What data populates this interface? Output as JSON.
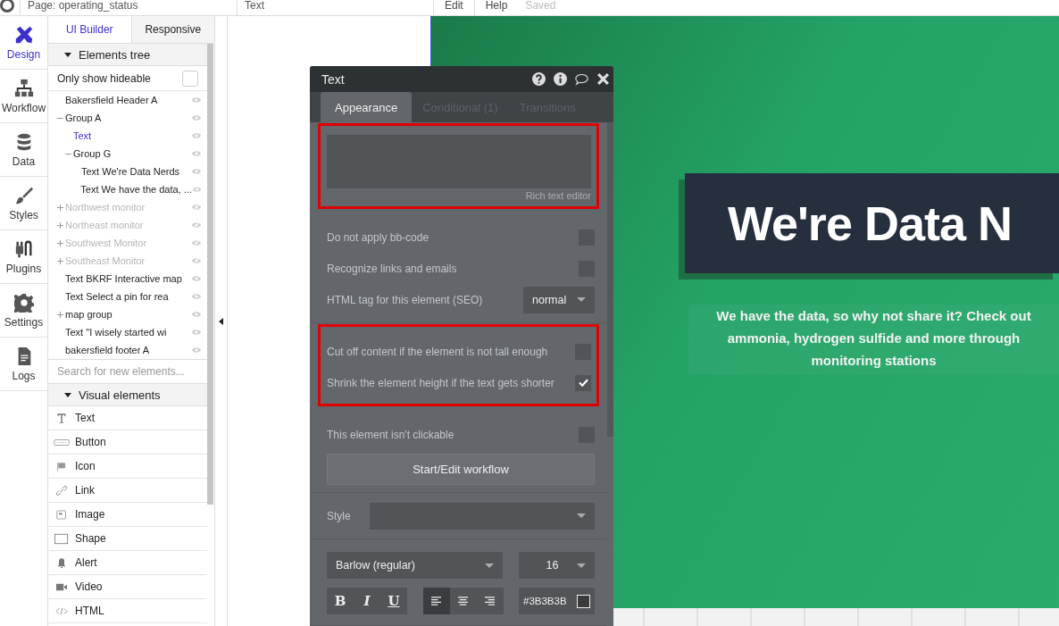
{
  "top_bar": {
    "page_select": "Page: operating_status",
    "element_select": "Text",
    "menu": [
      "Edit",
      "Help"
    ],
    "status": "Saved"
  },
  "nav": [
    {
      "label": "Design",
      "selected": true
    },
    {
      "label": "Workflow",
      "selected": false
    },
    {
      "label": "Data",
      "selected": false
    },
    {
      "label": "Styles",
      "selected": false
    },
    {
      "label": "Plugins",
      "selected": false
    },
    {
      "label": "Settings",
      "selected": false
    },
    {
      "label": "Logs",
      "selected": false
    }
  ],
  "panel_tabs": [
    {
      "label": "UI Builder",
      "selected": true
    },
    {
      "label": "Responsive",
      "selected": false
    }
  ],
  "elements_tree": {
    "title": "Elements tree",
    "expanded": true,
    "only_hideable": {
      "label": "Only show hideable",
      "checked": false
    },
    "items": [
      {
        "label": "Bakersfield Header A",
        "hidden": false,
        "selected": false
      },
      {
        "label": "Group A",
        "hidden": false,
        "selected": false,
        "expanded": true,
        "children": [
          {
            "label": "Text",
            "hidden": false,
            "selected": true
          },
          {
            "label": "Group G",
            "hidden": false,
            "selected": false,
            "expanded": true,
            "children": [
              {
                "label": "Text We're Data Nerds",
                "hidden": false,
                "selected": false
              },
              {
                "label": "Text We have the data, ...",
                "hidden": false,
                "selected": false
              }
            ]
          }
        ]
      },
      {
        "label": "Northwest monitor",
        "hidden": true,
        "selected": false,
        "expanded": false
      },
      {
        "label": "Northeast monitor",
        "hidden": true,
        "selected": false,
        "expanded": false
      },
      {
        "label": "Southwest Monitor",
        "hidden": true,
        "selected": false,
        "expanded": false
      },
      {
        "label": "Southeast Monitor",
        "hidden": true,
        "selected": false,
        "expanded": false
      },
      {
        "label": "Text BKRF Interactive map",
        "hidden": false,
        "selected": false
      },
      {
        "label": "Text Select a pin for rea",
        "hidden": false,
        "selected": false
      },
      {
        "label": "map group",
        "hidden": false,
        "selected": false,
        "expanded": false
      },
      {
        "label": "Text \"I wisely started wi",
        "hidden": false,
        "selected": false
      },
      {
        "label": "bakersfield footer A",
        "hidden": false,
        "selected": false
      }
    ],
    "search": {
      "placeholder": "Search for new elements..."
    }
  },
  "visual_elements": {
    "title": "Visual elements",
    "expanded": true,
    "items": [
      "Text",
      "Button",
      "Icon",
      "Link",
      "Image",
      "Shape",
      "Alert",
      "Video",
      "HTML"
    ]
  },
  "editor": {
    "title": "Text",
    "tabs": [
      {
        "label": "Appearance",
        "selected": true
      },
      {
        "label": "Conditional (1)",
        "selected": false
      },
      {
        "label": "Transitions",
        "selected": false
      }
    ],
    "sections": [
      {
        "highlighted": true,
        "rows": [
          {
            "kind": "richtext",
            "caption": "Rich text editor"
          }
        ]
      },
      {
        "highlighted": false,
        "rows": [
          {
            "kind": "checkbox",
            "label": "Do not apply bb-code",
            "checked": false
          },
          {
            "kind": "checkbox",
            "label": "Recognize links and emails",
            "checked": false
          },
          {
            "kind": "select",
            "label": "HTML tag for this element (SEO)",
            "value": "normal"
          }
        ]
      },
      {
        "highlighted": true,
        "rows": [
          {
            "kind": "checkbox",
            "label": "Cut off content if the element is not tall enough",
            "checked": false
          },
          {
            "kind": "checkbox",
            "label": "Shrink the element height if the text gets shorter",
            "checked": true
          }
        ]
      },
      {
        "highlighted": false,
        "rows": [
          {
            "kind": "checkbox",
            "label": "This element isn't clickable",
            "checked": false
          },
          {
            "kind": "button",
            "label": "Start/Edit workflow"
          }
        ]
      },
      {
        "highlighted": false,
        "rows": [
          {
            "kind": "style",
            "label": "Style"
          }
        ]
      },
      {
        "highlighted": false,
        "rows": [
          {
            "kind": "font",
            "font": "Barlow (regular)",
            "size": "16",
            "format": [
              {
                "label": "B",
                "selected": false
              },
              {
                "label": "I",
                "selected": false
              },
              {
                "label": "U",
                "selected": false
              }
            ],
            "align": [
              {
                "selected": true
              },
              {
                "selected": false
              },
              {
                "selected": false
              }
            ],
            "color": "#3B3B3B"
          }
        ]
      }
    ]
  },
  "canvas": {
    "heading": "We're Data N",
    "subtitle": [
      "We have the data, so why not share it? Check out",
      "ammonia, hydrogen sulfide and more through",
      "monitoring stations"
    ]
  }
}
